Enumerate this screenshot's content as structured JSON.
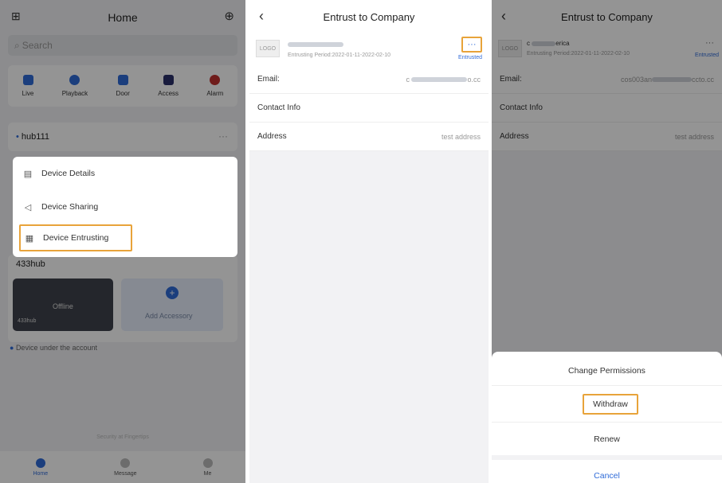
{
  "panel1": {
    "title": "Home",
    "search_placeholder": "Search",
    "quick_actions": [
      {
        "label": "Live",
        "icon": "live-icon",
        "color": "#2f6bd8"
      },
      {
        "label": "Playback",
        "icon": "playback-icon",
        "color": "#2f6bd8"
      },
      {
        "label": "Door",
        "icon": "door-icon",
        "color": "#2f6bd8"
      },
      {
        "label": "Access",
        "icon": "access-icon",
        "color": "#2a2f6a"
      },
      {
        "label": "Alarm",
        "icon": "alarm-icon",
        "color": "#c0312f"
      }
    ],
    "hub1_name": "hub111",
    "hub2_name": "433hub",
    "menu": [
      {
        "label": "Device Details",
        "icon": "device-details-icon"
      },
      {
        "label": "Device Sharing",
        "icon": "device-sharing-icon"
      },
      {
        "label": "Device Entrusting",
        "icon": "device-entrusting-icon"
      }
    ],
    "tile_offline": "Offline",
    "tile_offline_name": "433hub",
    "tile_add": "Add Accessory",
    "device_note": "Device under the account",
    "footer_text": "Security at Fingertips",
    "tabs": [
      "Home",
      "Message",
      "Me"
    ],
    "accent": "#2f6bd8"
  },
  "panel2": {
    "title": "Entrust to Company",
    "logo": "LOGO",
    "period": "Entrusting Period:2022-01-11-2022-02-10",
    "status": "Entrusted",
    "more": "···",
    "email_label": "Email:",
    "email_prefix": "c",
    "email_suffix": "o.cc",
    "contact_label": "Contact Info",
    "address_label": "Address",
    "address_value": "test address",
    "status_color": "#2f6bd8"
  },
  "panel3": {
    "title": "Entrust to Company",
    "logo": "LOGO",
    "company_prefix": "c",
    "company_suffix": "erica",
    "period": "Entrusting Period:2022-01-11-2022-02-10",
    "status": "Entrusted",
    "more": "···",
    "email_label": "Email:",
    "email_prefix": "cos003an",
    "email_suffix": "ccto.cc",
    "contact_label": "Contact Info",
    "address_label": "Address",
    "address_value": "test address",
    "options": [
      "Change Permissions",
      "Withdraw",
      "Renew",
      "Cancel"
    ],
    "highlight_color": "#e8a33a"
  }
}
